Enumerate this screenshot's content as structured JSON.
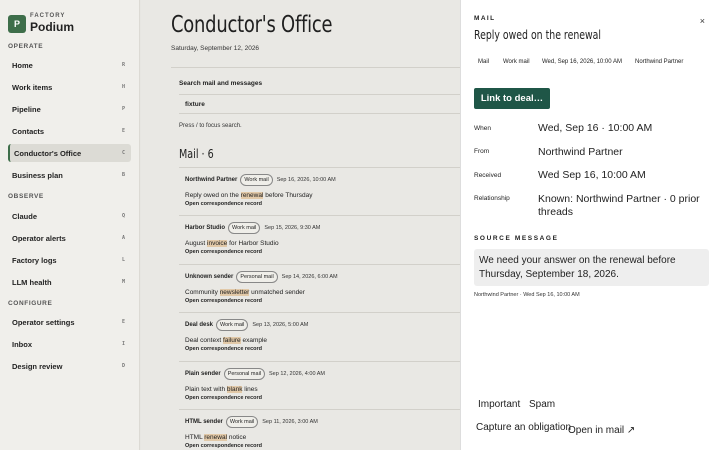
{
  "brand": {
    "logo": "P",
    "kicker": "FACTORY",
    "name": "Podium"
  },
  "sidebar": {
    "sections": [
      "OPERATE",
      "OBSERVE",
      "CONFIGURE"
    ],
    "items": [
      {
        "label": "Home",
        "key": "R"
      },
      {
        "label": "Work items",
        "key": "H"
      },
      {
        "label": "Pipeline",
        "key": "P"
      },
      {
        "label": "Contacts",
        "key": "E"
      },
      {
        "label": "Conductor's Office",
        "key": "C"
      },
      {
        "label": "Business plan",
        "key": "B"
      },
      {
        "label": "Claude",
        "key": "Q"
      },
      {
        "label": "Operator alerts",
        "key": "A"
      },
      {
        "label": "Factory logs",
        "key": "L"
      },
      {
        "label": "LLM health",
        "key": "M"
      },
      {
        "label": "Operator settings",
        "key": "E"
      },
      {
        "label": "Inbox",
        "key": "I"
      },
      {
        "label": "Design review",
        "key": "D"
      }
    ]
  },
  "main": {
    "title": "Conductor's Office",
    "date": "Saturday, September 12, 2026",
    "search_label": "Search mail and messages",
    "search_value": "fixture",
    "search_hint": "Press / to focus search.",
    "mail_heading": "Mail · 6",
    "mails": [
      {
        "sender": "Northwind Partner",
        "badge": "Work mail",
        "when": "Sep 16, 2026, 10:00 AM",
        "pre": "Reply owed on the ",
        "hl": "renewal",
        "post": " before Thursday",
        "link": "Open correspondence record"
      },
      {
        "sender": "Harbor Studio",
        "badge": "Work mail",
        "when": "Sep 15, 2026, 9:30 AM",
        "pre": "August ",
        "hl": "invoice",
        "post": " for Harbor Studio",
        "link": "Open correspondence record"
      },
      {
        "sender": "Unknown sender",
        "badge": "Personal mail",
        "when": "Sep 14, 2026, 6:00 AM",
        "pre": "Community ",
        "hl": "newsletter",
        "post": " unmatched sender",
        "link": "Open correspondence record"
      },
      {
        "sender": "Deal desk",
        "badge": "Work mail",
        "when": "Sep 13, 2026, 5:00 AM",
        "pre": "Deal context ",
        "hl": "failure",
        "post": " example",
        "link": "Open correspondence record"
      },
      {
        "sender": "Plain sender",
        "badge": "Personal mail",
        "when": "Sep 12, 2026, 4:00 AM",
        "pre": "Plain text with ",
        "hl": "blank",
        "post": " lines",
        "link": "Open correspondence record"
      },
      {
        "sender": "HTML sender",
        "badge": "Work mail",
        "when": "Sep 11, 2026, 3:00 AM",
        "pre": "HTML ",
        "hl": "renewal",
        "post": " notice",
        "link": "Open correspondence record"
      }
    ]
  },
  "panel": {
    "close": "×",
    "kicker": "MAIL",
    "title": "Reply owed on the renewal",
    "meta": [
      "Mail",
      "Work mail",
      "Wed, Sep 16, 2026, 10:00 AM",
      "Northwind Partner"
    ],
    "link_button": "Link to deal…",
    "fields": [
      {
        "label": "When",
        "value": "Wed, Sep 16 · 10:00 AM"
      },
      {
        "label": "From",
        "value": "Northwind Partner"
      },
      {
        "label": "Received",
        "value": "Wed Sep 16, 10:00 AM"
      },
      {
        "label": "Relationship",
        "value": "Known: Northwind Partner · 0 prior threads"
      }
    ],
    "source_label": "SOURCE MESSAGE",
    "source_text": "We need your answer on the renewal before Thursday, September 18, 2026.",
    "source_foot": "Northwind Partner · Wed Sep 16, 10:00 AM",
    "actions": {
      "important": "Important",
      "spam": "Spam",
      "capture": "Capture an obligation",
      "open_mail": "Open in mail ↗"
    }
  },
  "colors": {
    "accent": "#1f5647",
    "brand": "#3e6e4a",
    "highlight": "#e2c9a8"
  }
}
